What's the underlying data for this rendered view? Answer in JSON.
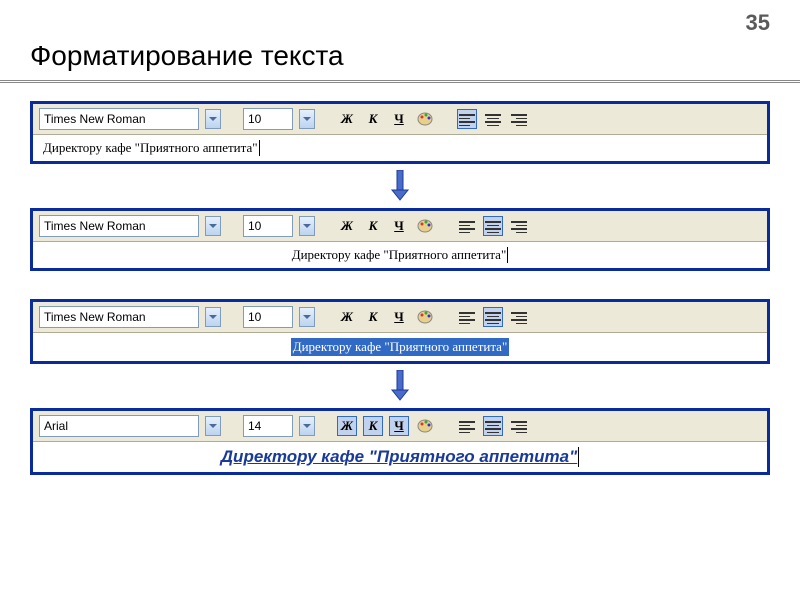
{
  "slide": {
    "page_number": "35",
    "title": "Форматирование текста"
  },
  "panels": [
    {
      "font": "Times New Roman",
      "size": "10",
      "bold": "Ж",
      "italic": "К",
      "under": "Ч",
      "active_btn": "left",
      "text": "Директору кафе \"Приятного аппетита\"",
      "text_align": "left",
      "selected": false,
      "styled": false
    },
    {
      "font": "Times New Roman",
      "size": "10",
      "bold": "Ж",
      "italic": "К",
      "under": "Ч",
      "active_btn": "center",
      "text": "Директору кафе \"Приятного аппетита\"",
      "text_align": "center",
      "selected": false,
      "styled": false
    },
    {
      "font": "Times New Roman",
      "size": "10",
      "bold": "Ж",
      "italic": "К",
      "under": "Ч",
      "active_btn": "center",
      "text": "Директору кафе \"Приятного аппетита\"",
      "text_align": "center",
      "selected": true,
      "styled": false
    },
    {
      "font": "Arial",
      "size": "14",
      "bold": "Ж",
      "italic": "К",
      "under": "Ч",
      "active_btn": "center",
      "text": "Директору кафе \"Приятного аппетита\"",
      "text_align": "center",
      "selected": false,
      "styled": true
    }
  ]
}
